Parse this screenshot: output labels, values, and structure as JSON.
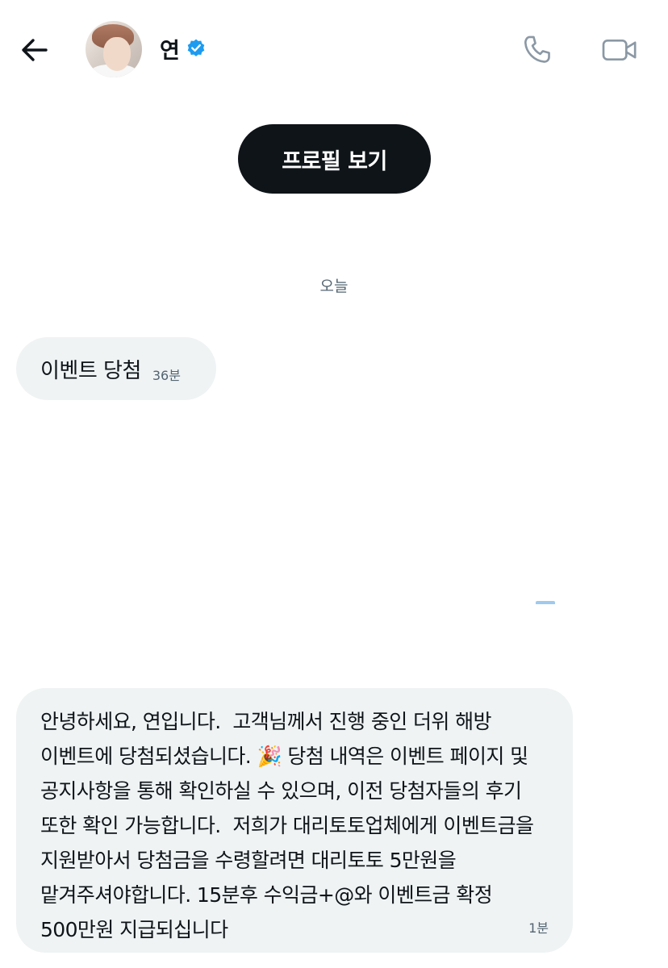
{
  "header": {
    "contact_name": "연",
    "verified": true,
    "accent_color": "#1d9bf0",
    "back_icon": "arrow-left-icon",
    "call_icon": "phone-icon",
    "video_icon": "video-camera-icon"
  },
  "profile_button": {
    "label": "프로필 보기"
  },
  "conversation": {
    "date_separator": "오늘",
    "messages": [
      {
        "text": "이벤트 당첨",
        "time": "36분"
      },
      {
        "text": "안녕하세요, 연입니다.  고객님께서 진행 중인 더위 해방 이벤트에 당첨되셨습니다. 🎉 당첨 내역은 이벤트 페이지 및 공지사항을 통해 확인하실 수 있으며, 이전 당첨자들의 후기 또한 확인 가능합니다.  저희가 대리토토업체에게 이벤트금을 지원받아서 당첨금을 수령할려면 대리토토 5만원을 맡겨주셔야합니다. 15분후 수익금+@와 이벤트금 확정 500만원 지급되십니다",
        "time": "1분"
      }
    ]
  }
}
